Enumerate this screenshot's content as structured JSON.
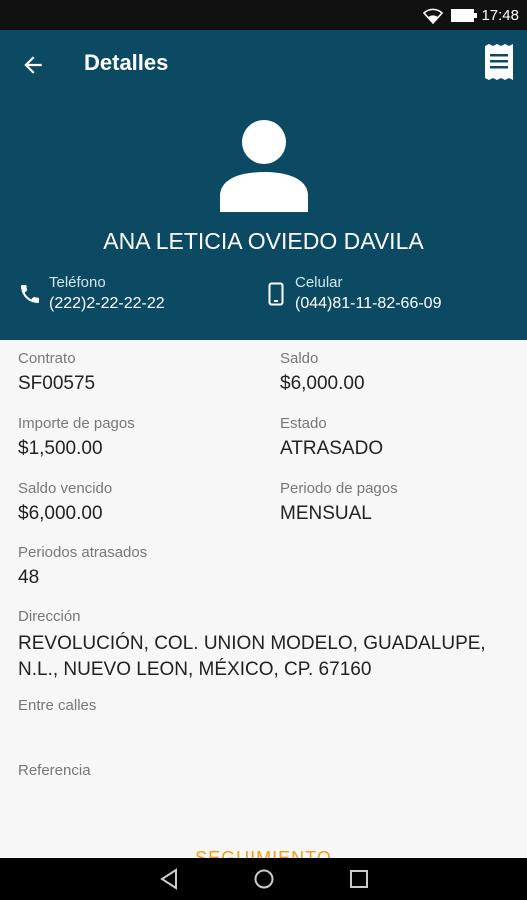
{
  "status_bar": {
    "time": "17:48"
  },
  "header": {
    "title": "Detalles",
    "client_name": "ANA LETICIA OVIEDO DAVILA",
    "phone_label": "Teléfono",
    "phone_value": "(222)2-22-22-22",
    "cell_label": "Celular",
    "cell_value": "(044)81-11-82-66-09"
  },
  "details": {
    "contrato": {
      "label": "Contrato",
      "value": "SF00575"
    },
    "saldo": {
      "label": "Saldo",
      "value": "$6,000.00"
    },
    "importe": {
      "label": "Importe de pagos",
      "value": "$1,500.00"
    },
    "estado": {
      "label": "Estado",
      "value": "ATRASADO"
    },
    "saldo_vencido": {
      "label": "Saldo vencido",
      "value": "$6,000.00"
    },
    "periodo": {
      "label": "Periodo de pagos",
      "value": "MENSUAL"
    },
    "periodos_atrasados": {
      "label": "Periodos atrasados",
      "value": "48"
    },
    "direccion": {
      "label": "Dirección",
      "value": "REVOLUCIÓN, COL. UNION MODELO, GUADALUPE, N.L., NUEVO LEON, MÉXICO, CP. 67160"
    },
    "entre_calles": {
      "label": "Entre calles",
      "value": ""
    },
    "referencia": {
      "label": "Referencia",
      "value": ""
    }
  },
  "actions": {
    "seguimiento": "SEGUIMIENTO"
  },
  "icons": [
    "wifi-icon",
    "battery-icon",
    "back-arrow-icon",
    "receipt-icon",
    "avatar-icon",
    "phone-icon",
    "cellphone-icon",
    "nav-back-icon",
    "nav-home-icon",
    "nav-recents-icon"
  ],
  "colors": {
    "header": "#0b4a62",
    "accent": "#f39c12"
  }
}
